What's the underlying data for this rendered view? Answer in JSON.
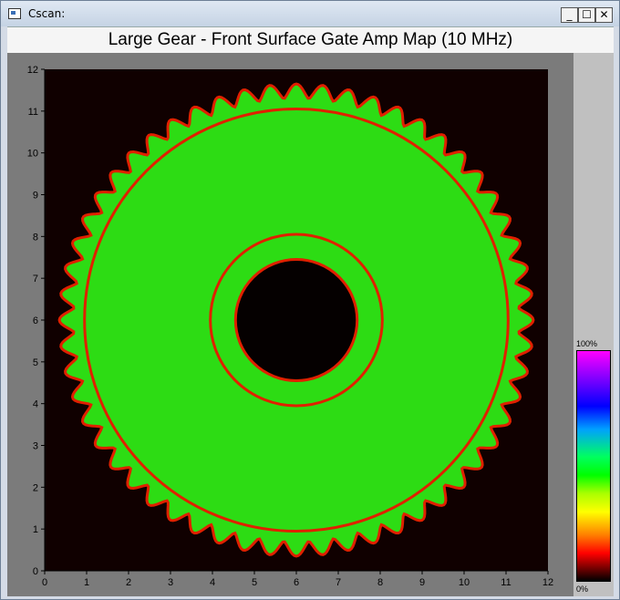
{
  "window": {
    "title": "Cscan:",
    "minimize_label": "_",
    "maximize_label": "☐",
    "close_label": "✕"
  },
  "plot": {
    "title": "Large Gear - Front Surface Gate Amp Map (10 MHz)",
    "x_ticks": [
      "0",
      "1",
      "2",
      "3",
      "4",
      "5",
      "6",
      "7",
      "8",
      "9",
      "10",
      "11",
      "12"
    ],
    "y_ticks": [
      "0",
      "1",
      "2",
      "3",
      "4",
      "5",
      "6",
      "7",
      "8",
      "9",
      "10",
      "11",
      "12"
    ],
    "xlim": [
      0,
      12
    ],
    "ylim": [
      0,
      12
    ],
    "gear": {
      "center": [
        6.0,
        6.0
      ],
      "tooth_count": 56,
      "outer_tip_radius": 5.65,
      "root_radius": 5.3,
      "rim_ring_radius": 5.05,
      "hub_outer_radius": 2.05,
      "bore_radius": 1.45
    }
  },
  "colorbar": {
    "max_label": "100%",
    "min_label": "0%"
  },
  "colors": {
    "background": "#100000",
    "material": "#2ddc14",
    "edge": "#e02000",
    "bore": "#050000"
  }
}
